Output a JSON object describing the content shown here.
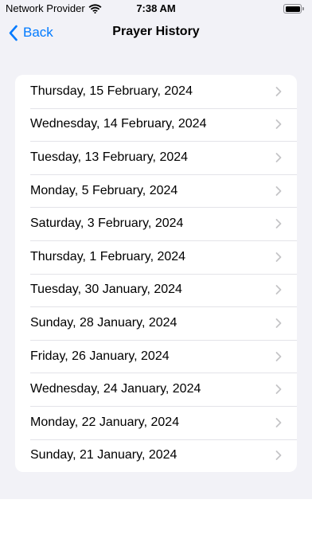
{
  "status_bar": {
    "carrier": "Network Provider",
    "time": "7:38 AM"
  },
  "nav": {
    "back_label": "Back",
    "title": "Prayer History"
  },
  "history": [
    {
      "label": "Thursday, 15 February, 2024"
    },
    {
      "label": "Wednesday, 14 February, 2024"
    },
    {
      "label": "Tuesday, 13 February, 2024"
    },
    {
      "label": "Monday, 5 February, 2024"
    },
    {
      "label": "Saturday, 3 February, 2024"
    },
    {
      "label": "Thursday, 1 February, 2024"
    },
    {
      "label": "Tuesday, 30 January, 2024"
    },
    {
      "label": "Sunday, 28 January, 2024"
    },
    {
      "label": "Friday, 26 January, 2024"
    },
    {
      "label": "Wednesday, 24 January, 2024"
    },
    {
      "label": "Monday, 22 January, 2024"
    },
    {
      "label": "Sunday, 21 January, 2024"
    }
  ],
  "colors": {
    "accent": "#007aff",
    "background": "#f2f2f7",
    "chevron": "#c4c4c7"
  },
  "icons": {
    "back": "chevron-left-icon",
    "row": "chevron-right-icon",
    "wifi": "wifi-icon",
    "battery": "battery-icon"
  }
}
